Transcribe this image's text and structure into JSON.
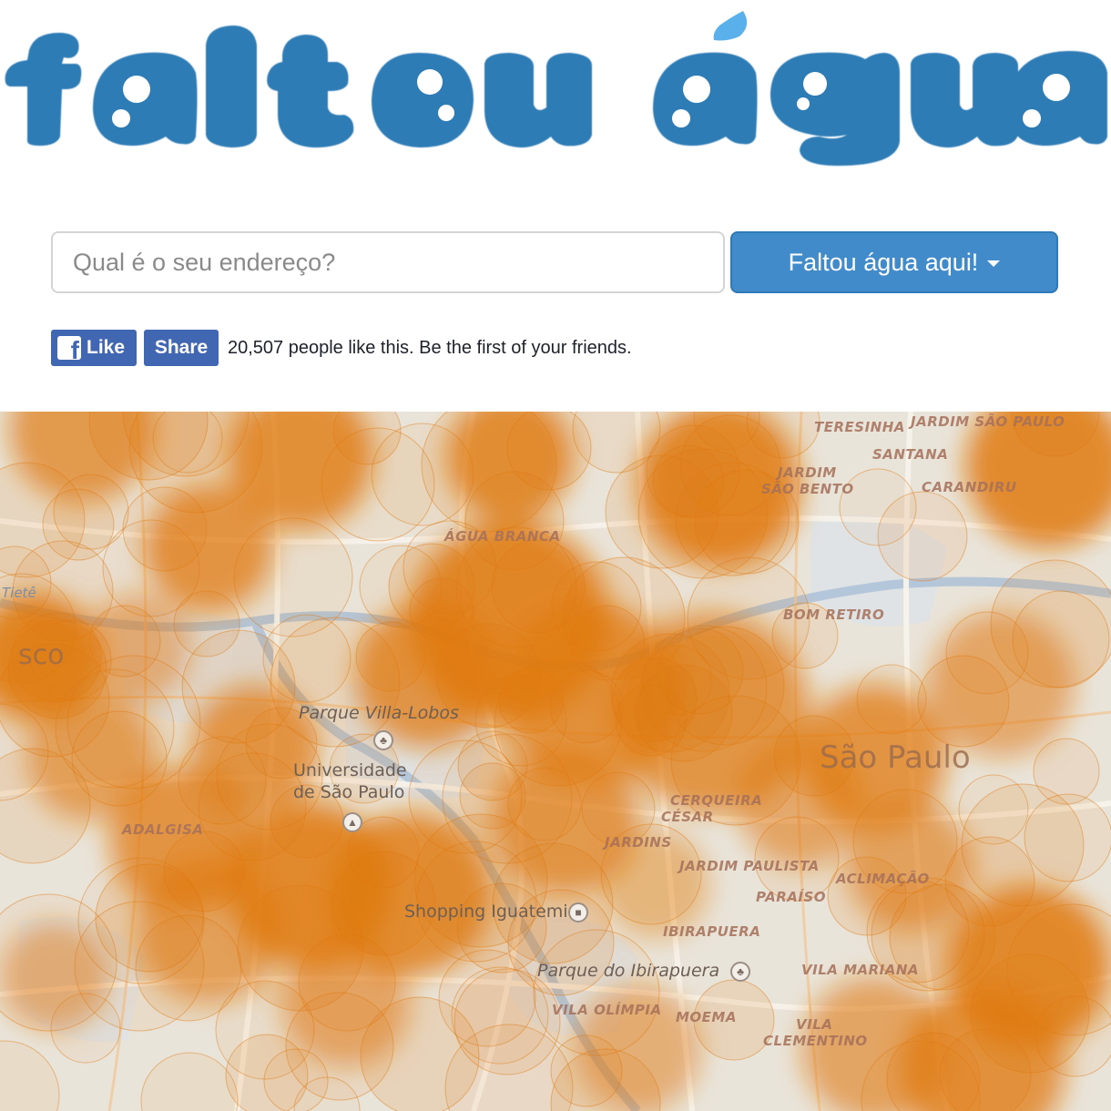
{
  "header": {
    "logo_text_1": "faltou",
    "logo_text_2": "água",
    "logo_color": "#2f7bb5",
    "drop_color": "#5ab0ea"
  },
  "search": {
    "placeholder": "Qual é o seu endereço?",
    "button_label": "Faltou água aqui!"
  },
  "facebook": {
    "like_label": "Like",
    "share_label": "Share",
    "social_text": "20,507 people like this. Be the first of your friends."
  },
  "map": {
    "heat_color": "#e07a10",
    "labels": {
      "tiete": "Tietê",
      "agua_branca": "ÁGUA BRANCA",
      "jardim_sao_bento_1": "JARDIM",
      "jardim_sao_bento_2": "SÃO BENTO",
      "carandiru": "CARANDIRU",
      "santana": "SANTANA",
      "teresinha": "TERESINHA",
      "sao_paulo_top": "JARDIM SÃO PAULO",
      "bom_retiro": "BOM RETIRO",
      "parque_villa_lobos": "Parque Villa-Lobos",
      "universidade_1": "Universidade",
      "universidade_2": "de São Paulo",
      "cerqueira_1": "CERQUEIRA",
      "cerqueira_2": "CÉSAR",
      "jardins": "JARDINS",
      "jardim_paulista": "JARDIM PAULISTA",
      "aclimacao": "ACLIMAÇÃO",
      "paraiso": "PARAÍSO",
      "shopping_iguatemi": "Shopping Iguatemi",
      "ibirapuera": "IBIRAPUERA",
      "parque_ibirapuera": "Parque do Ibirapuera",
      "vila_mariana": "VILA MARIANA",
      "vila_olimpia": "VILA OLÍMPIA",
      "moema": "MOEMA",
      "vila_clementino_1": "VILA",
      "vila_clementino_2": "CLEMENTINO",
      "adalgisa": "ADALGISA",
      "city": "São Paulo",
      "osasco_frag": "sco"
    }
  }
}
